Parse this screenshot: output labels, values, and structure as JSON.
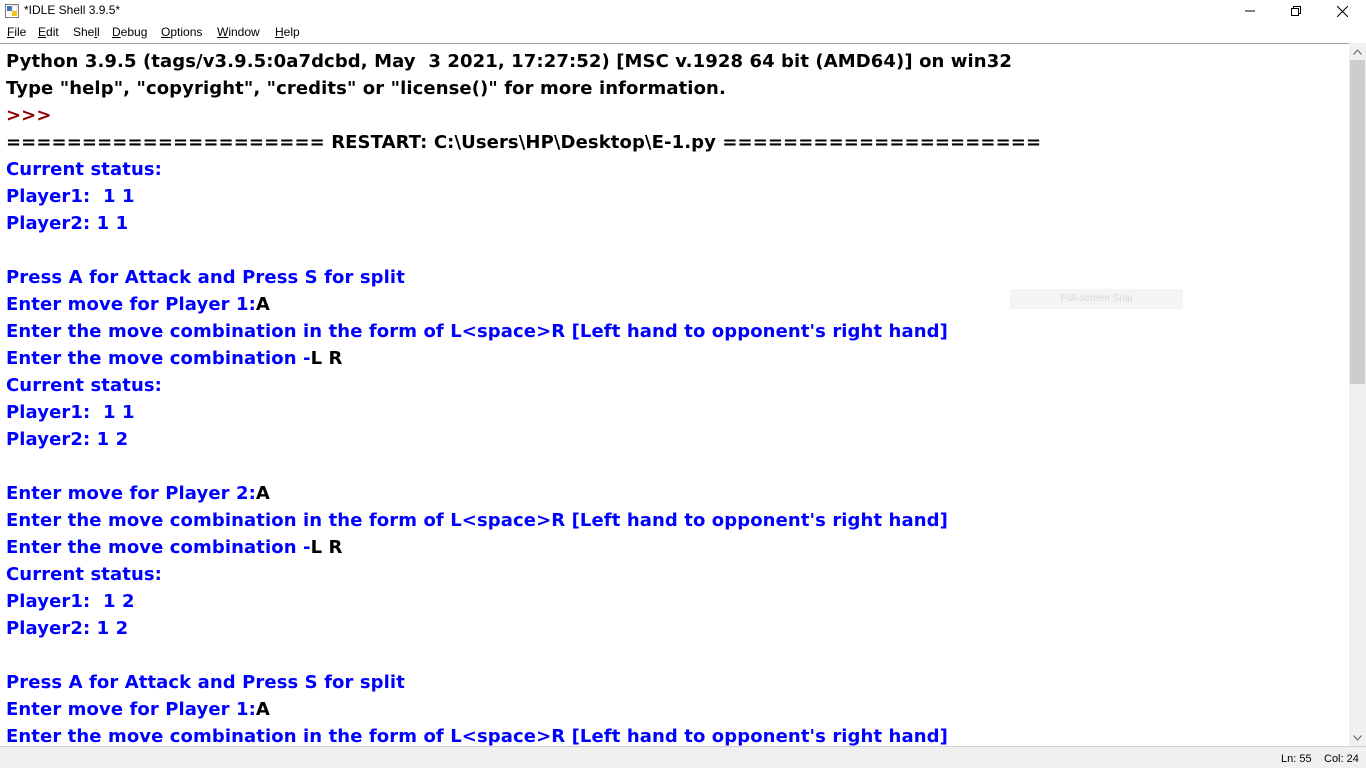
{
  "window": {
    "title": "*IDLE Shell 3.9.5*"
  },
  "menu": [
    {
      "label": "File",
      "accel_index": 0
    },
    {
      "label": "Edit",
      "accel_index": 0
    },
    {
      "label": "Shell",
      "accel_index": 3
    },
    {
      "label": "Debug",
      "accel_index": 0
    },
    {
      "label": "Options",
      "accel_index": 0
    },
    {
      "label": "Window",
      "accel_index": 0
    },
    {
      "label": "Help",
      "accel_index": 0
    }
  ],
  "shell_lines": [
    {
      "text": "Python 3.9.5 (tags/v3.9.5:0a7dcbd, May  3 2021, 17:27:52) [MSC v.1928 64 bit (AMD64)] on win32",
      "style": "black"
    },
    {
      "text": "Type \"help\", \"copyright\", \"credits\" or \"license()\" for more information.",
      "style": "black"
    },
    {
      "text": ">>> ",
      "style": "prompt"
    },
    {
      "text": "===================== RESTART: C:\\Users\\HP\\Desktop\\E-1.py =====================",
      "style": "black"
    },
    {
      "text": "Current status:",
      "style": "blue"
    },
    {
      "text": "Player1:  1 1",
      "style": "blue"
    },
    {
      "text": "Player2: 1 1",
      "style": "blue"
    },
    {
      "text": "",
      "style": "blue"
    },
    {
      "text": "Press A for Attack and Press S for split",
      "style": "blue"
    },
    {
      "text": "Enter move for Player 1:",
      "input": "A",
      "style": "blue"
    },
    {
      "text": "Enter the move combination in the form of L<space>R [Left hand to opponent's right hand]",
      "style": "blue"
    },
    {
      "text": "Enter the move combination -",
      "input": "L R",
      "style": "blue"
    },
    {
      "text": "Current status:",
      "style": "blue"
    },
    {
      "text": "Player1:  1 1",
      "style": "blue"
    },
    {
      "text": "Player2: 1 2",
      "style": "blue"
    },
    {
      "text": "",
      "style": "blue"
    },
    {
      "text": "Enter move for Player 2:",
      "input": "A",
      "style": "blue"
    },
    {
      "text": "Enter the move combination in the form of L<space>R [Left hand to opponent's right hand]",
      "style": "blue"
    },
    {
      "text": "Enter the move combination -",
      "input": "L R",
      "style": "blue"
    },
    {
      "text": "Current status:",
      "style": "blue"
    },
    {
      "text": "Player1:  1 2",
      "style": "blue"
    },
    {
      "text": "Player2: 1 2",
      "style": "blue"
    },
    {
      "text": "",
      "style": "blue"
    },
    {
      "text": "Press A for Attack and Press S for split",
      "style": "blue"
    },
    {
      "text": "Enter move for Player 1:",
      "input": "A",
      "style": "blue"
    },
    {
      "text": "Enter the move combination in the form of L<space>R [Left hand to opponent's right hand]",
      "style": "blue"
    }
  ],
  "overlay": {
    "snip_hint": "Full-screen Snip"
  },
  "status": {
    "ln": "Ln: 55",
    "col": "Col: 24"
  },
  "colors": {
    "stdout": "#0000ff",
    "normal": "#000000",
    "prompt": "#8b0000",
    "statusbar_bg": "#f0f0f0",
    "scroll_thumb": "#cdcdcd"
  },
  "icons": {
    "app": "python-idle-icon",
    "minimize": "minimize-icon",
    "maximize": "restore-icon",
    "close": "close-icon"
  }
}
